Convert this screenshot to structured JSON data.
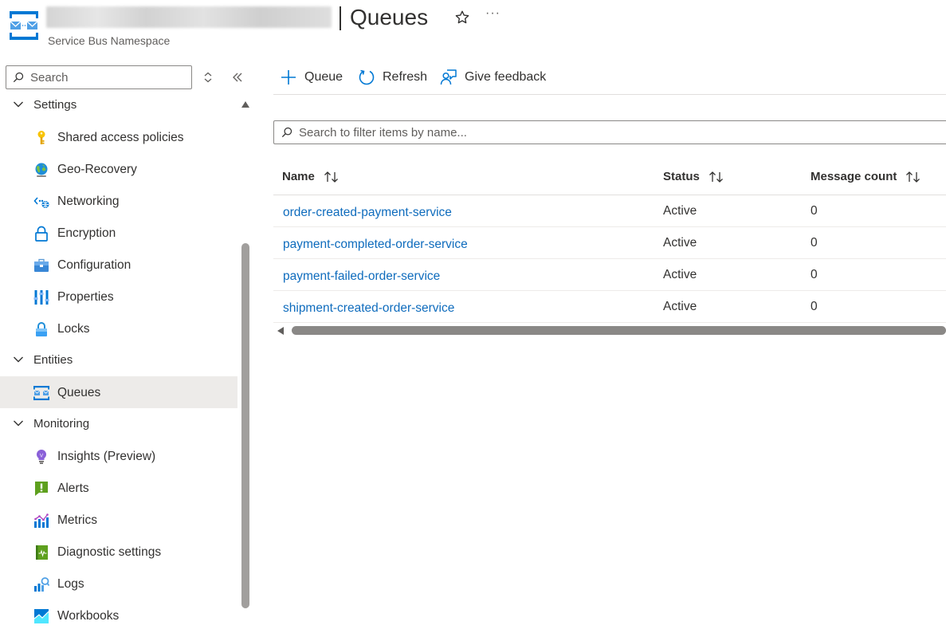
{
  "header": {
    "title": "Queues",
    "subtitle": "Service Bus Namespace",
    "more_label": "···"
  },
  "sidebar": {
    "search_placeholder": "Search",
    "groups": [
      {
        "label": "Settings",
        "items": [
          {
            "label": "Shared access policies",
            "icon": "key-icon"
          },
          {
            "label": "Geo-Recovery",
            "icon": "globe-icon"
          },
          {
            "label": "Networking",
            "icon": "networking-icon"
          },
          {
            "label": "Encryption",
            "icon": "lock-outline-icon"
          },
          {
            "label": "Configuration",
            "icon": "toolbox-icon"
          },
          {
            "label": "Properties",
            "icon": "properties-icon"
          },
          {
            "label": "Locks",
            "icon": "lock-icon"
          }
        ]
      },
      {
        "label": "Entities",
        "items": [
          {
            "label": "Queues",
            "icon": "queue-icon",
            "selected": true
          }
        ]
      },
      {
        "label": "Monitoring",
        "items": [
          {
            "label": "Insights (Preview)",
            "icon": "lightbulb-icon"
          },
          {
            "label": "Alerts",
            "icon": "alert-icon"
          },
          {
            "label": "Metrics",
            "icon": "metrics-icon"
          },
          {
            "label": "Diagnostic settings",
            "icon": "diagnostic-icon"
          },
          {
            "label": "Logs",
            "icon": "logs-icon"
          },
          {
            "label": "Workbooks",
            "icon": "workbooks-icon"
          }
        ]
      }
    ]
  },
  "toolbar": {
    "add_label": "Queue",
    "refresh_label": "Refresh",
    "feedback_label": "Give feedback"
  },
  "filter": {
    "placeholder": "Search to filter items by name..."
  },
  "table": {
    "columns": [
      "Name",
      "Status",
      "Message count"
    ],
    "rows": [
      {
        "name": "order-created-payment-service",
        "status": "Active",
        "count": "0"
      },
      {
        "name": "payment-completed-order-service",
        "status": "Active",
        "count": "0"
      },
      {
        "name": "payment-failed-order-service",
        "status": "Active",
        "count": "0"
      },
      {
        "name": "shipment-created-order-service",
        "status": "Active",
        "count": "0"
      }
    ]
  },
  "colors": {
    "link": "#0f6cbd",
    "accent": "#0078d4",
    "selected_bg": "#edebe9"
  }
}
